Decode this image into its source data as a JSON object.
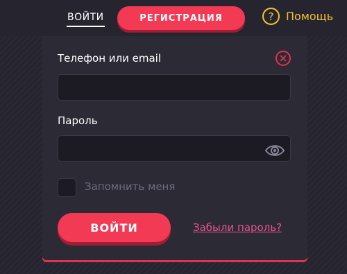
{
  "header": {
    "login_tab": "ВОЙТИ",
    "register_button": "РЕГИСТРАЦИЯ",
    "help_icon_glyph": "?",
    "help_label": "Помощь"
  },
  "form": {
    "login_label": "Телефон или email",
    "login_value": "",
    "password_label": "Пароль",
    "password_value": "",
    "remember_label": "Запомнить меня",
    "remember_checked": false,
    "submit_label": "ВОЙТИ",
    "forgot_link": "Забыли пароль?"
  },
  "icons": {
    "clear": "close-icon",
    "password_visibility": "eye-icon",
    "help": "question-icon"
  },
  "colors": {
    "accent": "#f23a55",
    "help": "#f2c233",
    "link": "#e8548d",
    "background": "#26252f"
  }
}
